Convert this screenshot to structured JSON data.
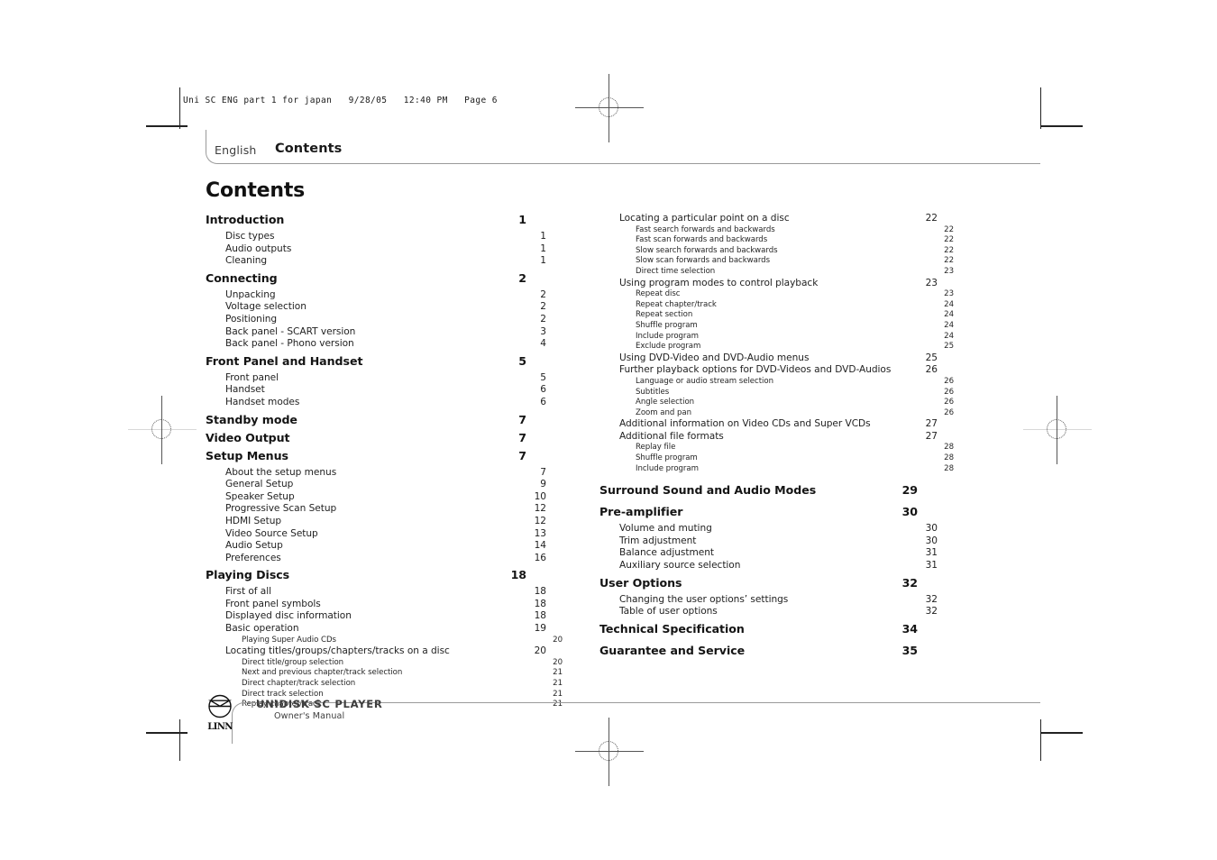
{
  "print_info": "Uni SC ENG part 1 for japan   9/28/05   12:40 PM   Page 6",
  "header": {
    "language": "English",
    "section": "Contents"
  },
  "page_title": "Contents",
  "footer": {
    "model": "UNIDISK SC PLAYER",
    "subtitle": "Owner's Manual",
    "logo_wordmark": "LINN",
    "logo_icon": "linn-roundel-icon"
  },
  "toc": {
    "left_column": [
      {
        "level": 0,
        "label": "Introduction",
        "page": "1",
        "gap": ""
      },
      {
        "level": 1,
        "label": "Disc types",
        "page": "1",
        "gap": ""
      },
      {
        "level": 1,
        "label": "Audio outputs",
        "page": "1",
        "gap": ""
      },
      {
        "level": 1,
        "label": "Cleaning",
        "page": "1",
        "gap": ""
      },
      {
        "level": 0,
        "label": "Connecting",
        "page": "2",
        "gap": "gap-sm"
      },
      {
        "level": 1,
        "label": "Unpacking",
        "page": "2",
        "gap": ""
      },
      {
        "level": 1,
        "label": "Voltage selection",
        "page": "2",
        "gap": ""
      },
      {
        "level": 1,
        "label": "Positioning",
        "page": "2",
        "gap": ""
      },
      {
        "level": 1,
        "label": "Back panel - SCART version",
        "page": "3",
        "gap": ""
      },
      {
        "level": 1,
        "label": "Back panel - Phono version",
        "page": "4",
        "gap": ""
      },
      {
        "level": 0,
        "label": "Front Panel and Handset",
        "page": "5",
        "gap": "gap-sm"
      },
      {
        "level": 1,
        "label": "Front panel",
        "page": "5",
        "gap": ""
      },
      {
        "level": 1,
        "label": "Handset",
        "page": "6",
        "gap": ""
      },
      {
        "level": 1,
        "label": "Handset modes",
        "page": "6",
        "gap": ""
      },
      {
        "level": 0,
        "label": "Standby mode",
        "page": "7",
        "gap": "gap-sm"
      },
      {
        "level": 0,
        "label": "Video Output",
        "page": "7",
        "gap": ""
      },
      {
        "level": 0,
        "label": "Setup Menus",
        "page": "7",
        "gap": ""
      },
      {
        "level": 1,
        "label": "About the setup menus",
        "page": "7",
        "gap": ""
      },
      {
        "level": 1,
        "label": "General Setup",
        "page": "9",
        "gap": ""
      },
      {
        "level": 1,
        "label": "Speaker Setup",
        "page": "10",
        "gap": ""
      },
      {
        "level": 1,
        "label": "Progressive Scan Setup",
        "page": "12",
        "gap": ""
      },
      {
        "level": 1,
        "label": "HDMI Setup",
        "page": "12",
        "gap": ""
      },
      {
        "level": 1,
        "label": "Video Source Setup",
        "page": "13",
        "gap": ""
      },
      {
        "level": 1,
        "label": "Audio Setup",
        "page": "14",
        "gap": ""
      },
      {
        "level": 1,
        "label": "Preferences",
        "page": "16",
        "gap": ""
      },
      {
        "level": 0,
        "label": "Playing Discs",
        "page": "18",
        "gap": "gap-sm"
      },
      {
        "level": 1,
        "label": "First of all",
        "page": "18",
        "gap": ""
      },
      {
        "level": 1,
        "label": "Front panel symbols",
        "page": "18",
        "gap": ""
      },
      {
        "level": 1,
        "label": "Displayed disc information",
        "page": "18",
        "gap": ""
      },
      {
        "level": 1,
        "label": "Basic operation",
        "page": "19",
        "gap": ""
      },
      {
        "level": 2,
        "label": "Playing Super Audio CDs",
        "page": "20",
        "gap": ""
      },
      {
        "level": 1,
        "label": "Locating titles/groups/chapters/tracks on a disc",
        "page": "20",
        "gap": ""
      },
      {
        "level": 2,
        "label": "Direct title/group selection",
        "page": "20",
        "gap": ""
      },
      {
        "level": 2,
        "label": "Next and previous chapter/track selection",
        "page": "21",
        "gap": ""
      },
      {
        "level": 2,
        "label": "Direct chapter/track selection",
        "page": "21",
        "gap": ""
      },
      {
        "level": 2,
        "label": "Direct track selection",
        "page": "21",
        "gap": ""
      },
      {
        "level": 2,
        "label": "Replay chapter/track",
        "page": "21",
        "gap": ""
      }
    ],
    "right_column": [
      {
        "level": 1,
        "label": "Locating a particular point on a disc",
        "page": "22",
        "gap": ""
      },
      {
        "level": 2,
        "label": "Fast search forwards and backwards",
        "page": "22",
        "gap": ""
      },
      {
        "level": 2,
        "label": "Fast scan forwards and backwards",
        "page": "22",
        "gap": ""
      },
      {
        "level": 2,
        "label": "Slow search forwards and backwards",
        "page": "22",
        "gap": ""
      },
      {
        "level": 2,
        "label": "Slow scan forwards and backwards",
        "page": "22",
        "gap": ""
      },
      {
        "level": 2,
        "label": "Direct time selection",
        "page": "23",
        "gap": ""
      },
      {
        "level": 1,
        "label": "Using program modes to control playback",
        "page": "23",
        "gap": ""
      },
      {
        "level": 2,
        "label": "Repeat disc",
        "page": "23",
        "gap": ""
      },
      {
        "level": 2,
        "label": "Repeat chapter/track",
        "page": "24",
        "gap": ""
      },
      {
        "level": 2,
        "label": "Repeat section",
        "page": "24",
        "gap": ""
      },
      {
        "level": 2,
        "label": "Shuffle program",
        "page": "24",
        "gap": ""
      },
      {
        "level": 2,
        "label": "Include program",
        "page": "24",
        "gap": ""
      },
      {
        "level": 2,
        "label": "Exclude program",
        "page": "25",
        "gap": ""
      },
      {
        "level": 1,
        "label": "Using DVD-Video and DVD-Audio menus",
        "page": "25",
        "gap": ""
      },
      {
        "level": 1,
        "label": "Further playback options for DVD-Videos and DVD-Audios",
        "page": "26",
        "gap": ""
      },
      {
        "level": 2,
        "label": "Language or audio stream selection",
        "page": "26",
        "gap": ""
      },
      {
        "level": 2,
        "label": "Subtitles",
        "page": "26",
        "gap": ""
      },
      {
        "level": 2,
        "label": "Angle selection",
        "page": "26",
        "gap": ""
      },
      {
        "level": 2,
        "label": "Zoom and pan",
        "page": "26",
        "gap": ""
      },
      {
        "level": 1,
        "label": "Additional information on Video CDs and Super VCDs",
        "page": "27",
        "gap": ""
      },
      {
        "level": 1,
        "label": "Additional file formats",
        "page": "27",
        "gap": ""
      },
      {
        "level": 2,
        "label": "Replay file",
        "page": "28",
        "gap": ""
      },
      {
        "level": 2,
        "label": "Shuffle program",
        "page": "28",
        "gap": ""
      },
      {
        "level": 2,
        "label": "Include program",
        "page": "28",
        "gap": ""
      },
      {
        "level": 0,
        "label": "Surround Sound and Audio Modes",
        "page": "29",
        "gap": "gap-md"
      },
      {
        "level": 0,
        "label": "Pre-amplifier",
        "page": "30",
        "gap": "gap-sm"
      },
      {
        "level": 1,
        "label": "Volume and muting",
        "page": "30",
        "gap": ""
      },
      {
        "level": 1,
        "label": "Trim adjustment",
        "page": "30",
        "gap": ""
      },
      {
        "level": 1,
        "label": "Balance adjustment",
        "page": "31",
        "gap": ""
      },
      {
        "level": 1,
        "label": "Auxiliary source selection",
        "page": "31",
        "gap": ""
      },
      {
        "level": 0,
        "label": "User Options",
        "page": "32",
        "gap": "gap-sm"
      },
      {
        "level": 1,
        "label": "Changing the user options’ settings",
        "page": "32",
        "gap": ""
      },
      {
        "level": 1,
        "label": "Table of user options",
        "page": "32",
        "gap": ""
      },
      {
        "level": 0,
        "label": "Technical Specification",
        "page": "34",
        "gap": "gap-sm"
      },
      {
        "level": 0,
        "label": "Guarantee and Service",
        "page": "35",
        "gap": "gap-sm"
      }
    ]
  }
}
